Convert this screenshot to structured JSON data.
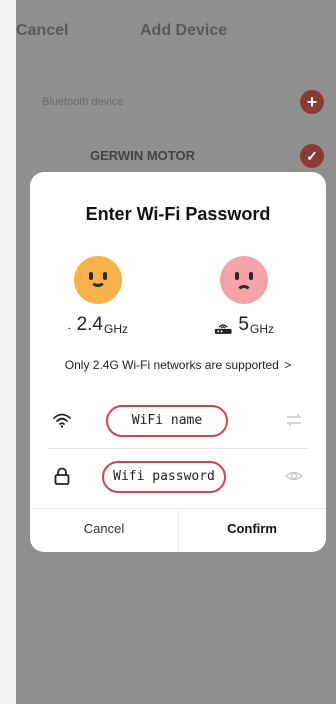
{
  "header": {
    "cancel_label": "Cancel",
    "title": "Add Device"
  },
  "list": {
    "bluetooth_label": "Bluetooth device",
    "device_name": "GERWIN MOTOR"
  },
  "modal": {
    "title": "Enter Wi-Fi Password",
    "bands": [
      {
        "freq": "2.4",
        "unit": "GHz",
        "face": "happy"
      },
      {
        "freq": "5",
        "unit": "GHz",
        "face": "sad"
      }
    ],
    "note": "Only 2.4G Wi-Fi networks are supported",
    "note_chevron": ">",
    "wifi_name_placeholder": "WiFi name",
    "wifi_password_placeholder": "Wifi password",
    "cancel_label": "Cancel",
    "confirm_label": "Confirm"
  },
  "colors": {
    "accent_red": "#d7424d",
    "happy_face": "#f7b24a",
    "sad_face": "#f4a3a8",
    "dim_overlay": "#8f8f8f"
  },
  "icons": {
    "wifi": "wifi-icon",
    "lock": "lock-icon",
    "router": "router-icon",
    "swap": "swap-icon",
    "eye": "eye-icon",
    "plus": "plus-icon",
    "check": "check-icon"
  }
}
